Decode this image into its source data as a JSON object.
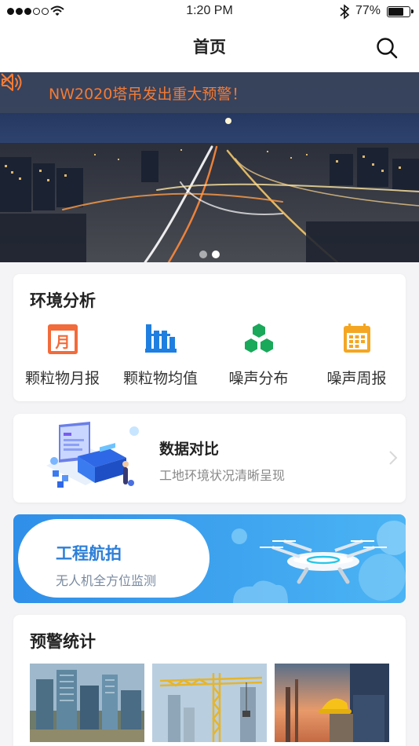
{
  "status_bar": {
    "time": "1:20 PM",
    "battery": "77%",
    "battery_level": 0.77,
    "signal_bars": 3,
    "signal_total": 5,
    "icons": [
      "signal-icon",
      "wifi-icon",
      "bluetooth-icon",
      "battery-icon"
    ]
  },
  "nav": {
    "title": "首页",
    "search_icon": "search-icon"
  },
  "banner": {
    "notice_text": "NW2020塔吊发出重大预警！",
    "notice_icon": "speaker-icon",
    "close_icon": "close-icon",
    "slide_count": 2,
    "active_slide": 1,
    "accent": "#f47a33"
  },
  "env_analysis": {
    "title": "环境分析",
    "items": [
      {
        "label": "颗粒物月报",
        "icon": "monthly-calendar-icon",
        "color": "#f26b3a",
        "glyph": "月"
      },
      {
        "label": "颗粒物均值",
        "icon": "bar-chart-icon",
        "color": "#1f7fe0"
      },
      {
        "label": "噪声分布",
        "icon": "hexagons-icon",
        "color": "#1aa85a"
      },
      {
        "label": "噪声周报",
        "icon": "weekly-calendar-icon",
        "color": "#f4a623"
      }
    ]
  },
  "data_compare": {
    "title": "数据对比",
    "subtitle": "工地环境状况清晰呈现",
    "chevron_icon": "chevron-right-icon"
  },
  "aerial": {
    "title": "工程航拍",
    "subtitle": "无人机全方位监测",
    "illustration": "drone-icon"
  },
  "warnings": {
    "title": "预警统计",
    "thumbs": [
      "construction-buildings-photo",
      "tower-crane-photo",
      "worker-helmet-photo"
    ]
  }
}
